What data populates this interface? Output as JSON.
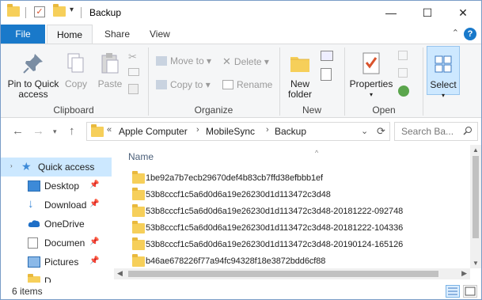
{
  "window": {
    "title": "Backup",
    "controls": {
      "minimize": "—",
      "maximize": "☐",
      "close": "✕"
    }
  },
  "ribbon_tabs": {
    "file": "File",
    "home": "Home",
    "share": "Share",
    "view": "View"
  },
  "ribbon": {
    "clipboard": {
      "pin": "Pin to Quick access",
      "copy": "Copy",
      "paste": "Paste",
      "label": "Clipboard"
    },
    "organize": {
      "move_to": "Move to",
      "copy_to": "Copy to",
      "delete": "Delete",
      "rename": "Rename",
      "label": "Organize"
    },
    "new": {
      "new_folder": "New folder",
      "label": "New"
    },
    "open": {
      "properties": "Properties",
      "label": "Open"
    },
    "select": {
      "select": "Select"
    }
  },
  "address": {
    "prefix": "«",
    "crumbs": [
      "Apple Computer",
      "MobileSync",
      "Backup"
    ],
    "search_placeholder": "Search Ba..."
  },
  "nav_pane": {
    "items": [
      {
        "label": "Quick access",
        "icon": "star-icon"
      },
      {
        "label": "Desktop",
        "icon": "desktop-icon"
      },
      {
        "label": "Download",
        "icon": "download-icon"
      },
      {
        "label": "OneDrive",
        "icon": "cloud-icon"
      },
      {
        "label": "Documen",
        "icon": "document-icon"
      },
      {
        "label": "Pictures",
        "icon": "pictures-icon"
      },
      {
        "label": "D",
        "icon": "folder-icon"
      }
    ]
  },
  "file_list": {
    "column_name": "Name",
    "files": [
      "1be92a7b7ecb29670def4b83cb7ffd38efbbb1ef",
      "53b8cccf1c5a6d0d6a19e26230d1d113472c3d48",
      "53b8cccf1c5a6d0d6a19e26230d1d113472c3d48-20181222-092748",
      "53b8cccf1c5a6d0d6a19e26230d1d113472c3d48-20181222-104336",
      "53b8cccf1c5a6d0d6a19e26230d1d113472c3d48-20190124-165126",
      "b46ae678226f77a94fc94328f18e3872bdd6cf88"
    ]
  },
  "status": {
    "item_count": "6 items"
  },
  "colors": {
    "accent": "#1979ca",
    "folder": "#f6cf5a",
    "selection": "#cce8ff"
  }
}
